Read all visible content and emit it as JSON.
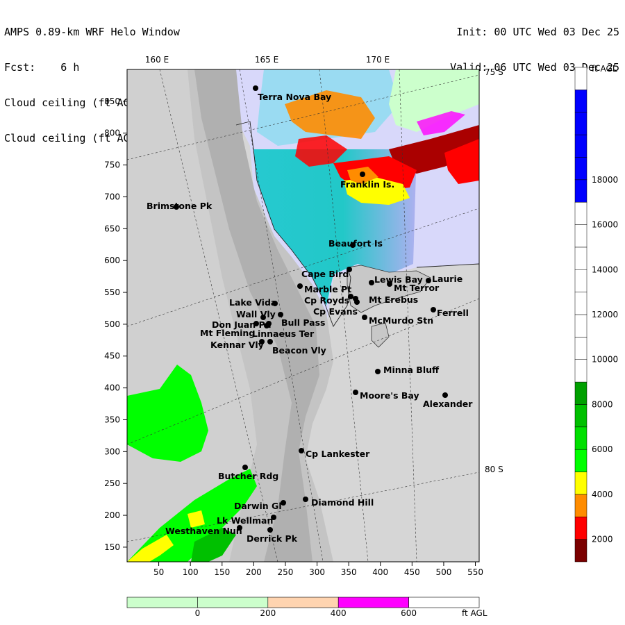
{
  "header": {
    "title": "AMPS 0.89-km WRF Helo Window",
    "forecast": "Fcst:    6 h",
    "field_line_1": "Cloud ceiling (ft AGL)",
    "field_line_2": "Cloud ceiling (ft AGL)",
    "init": "Init: 00 UTC Wed 03 Dec 25",
    "valid": "Valid: 06 UTC Wed 03 Dec 25"
  },
  "longitude_labels": [
    "160 E",
    "165 E",
    "170 E"
  ],
  "latitude_labels": [
    "75 S",
    "80 S"
  ],
  "x_axis": {
    "ticks": [
      50,
      100,
      150,
      200,
      250,
      300,
      350,
      400,
      450,
      500,
      550
    ]
  },
  "y_axis": {
    "ticks": [
      150,
      200,
      250,
      300,
      350,
      400,
      450,
      500,
      550,
      600,
      650,
      700,
      750,
      800,
      850
    ]
  },
  "ceiling_colorbar": {
    "unit": "ft AGL",
    "labels": [
      "2000",
      "4000",
      "6000",
      "8000",
      "10000",
      "12000",
      "14000",
      "16000",
      "18000"
    ],
    "colors": [
      "#7a0000",
      "#ff0000",
      "#ff8c00",
      "#ffff00",
      "#00ff00",
      "#00e000",
      "#00c000",
      "#00a000",
      "#ffffff",
      "#ffffff",
      "#ffffff",
      "#ffffff",
      "#ffffff",
      "#ffffff",
      "#ffffff",
      "#ffffff",
      "#0000ff",
      "#0000ff",
      "#0000ff",
      "#0000ff",
      "#0000ff",
      "#ffffff"
    ]
  },
  "terrain_colorbar": {
    "unit": "ft AGL",
    "labels": [
      "0",
      "200",
      "400",
      "600"
    ],
    "colors": [
      "#ccffcc",
      "#ccffcc",
      "#ffd4b0",
      "#ff00ff",
      "#ffffff"
    ]
  },
  "stations": [
    {
      "name": "Terra Nova Bay"
    },
    {
      "name": "Franklin Is."
    },
    {
      "name": "Brimstone Pk"
    },
    {
      "name": "Beaufort Is"
    },
    {
      "name": "Cape Bird"
    },
    {
      "name": "Lewis Bay"
    },
    {
      "name": "Laurie"
    },
    {
      "name": "Mt Terror"
    },
    {
      "name": "Marble Pt"
    },
    {
      "name": "Cp Royds"
    },
    {
      "name": "Mt Erebus"
    },
    {
      "name": "Lake Vida"
    },
    {
      "name": "Cp Evans"
    },
    {
      "name": "Ferrell"
    },
    {
      "name": "Wall Vly"
    },
    {
      "name": "Bull Pass"
    },
    {
      "name": "McMurdo Stn"
    },
    {
      "name": "Don Juan Pd"
    },
    {
      "name": "Mt Fleming"
    },
    {
      "name": "Linnaeus Ter"
    },
    {
      "name": "Kennar Vly"
    },
    {
      "name": "Beacon Vly"
    },
    {
      "name": "Minna Bluff"
    },
    {
      "name": "Moore's Bay"
    },
    {
      "name": "Alexander"
    },
    {
      "name": "Cp Lankester"
    },
    {
      "name": "Butcher Rdg"
    },
    {
      "name": "Darwin Gl"
    },
    {
      "name": "Diamond Hill"
    },
    {
      "name": "Lk Wellman"
    },
    {
      "name": "Westhaven Nun"
    },
    {
      "name": "Derrick Pk"
    }
  ]
}
